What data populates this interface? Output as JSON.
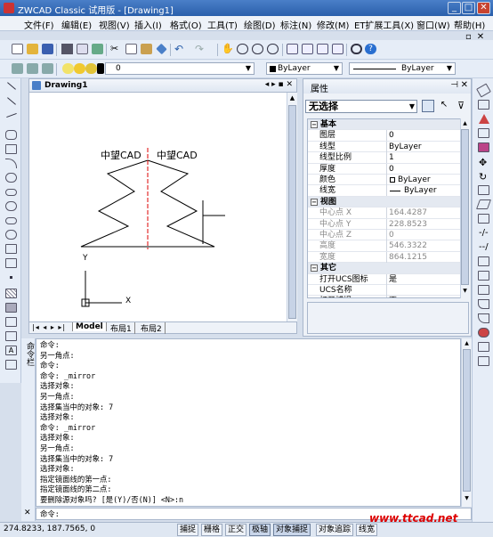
{
  "window": {
    "title": "ZWCAD Classic 试用版 - [Drawing1]",
    "controls": [
      "_",
      "□",
      "✕"
    ],
    "mdi_controls": [
      "_",
      "▫",
      "✕"
    ]
  },
  "menu": [
    "文件(F)",
    "编辑(E)",
    "视图(V)",
    "插入(I)",
    "格式(O)",
    "工具(T)",
    "绘图(D)",
    "标注(N)",
    "修改(M)",
    "ET扩展工具(X)",
    "窗口(W)",
    "帮助(H)"
  ],
  "layer_combo": "0",
  "color_combo": "ByLayer",
  "linetype_combo": "ByLayer",
  "drawing": {
    "tab_title": "Drawing1",
    "text_left": "中望CAD",
    "text_right": "中望CAD",
    "ucs_y": "Y",
    "ucs_x": "X",
    "layout_tabs": [
      "Model",
      "布局1",
      "布局2"
    ]
  },
  "properties": {
    "header": "属性",
    "selection": "无选择",
    "rows": [
      {
        "cat": true,
        "key": "基本"
      },
      {
        "key": "图层",
        "value": "0"
      },
      {
        "key": "线型",
        "value": "ByLayer"
      },
      {
        "key": "线型比例",
        "value": "1"
      },
      {
        "key": "厚度",
        "value": "0"
      },
      {
        "key": "颜色",
        "value": "ByLayer"
      },
      {
        "key": "线宽",
        "value": "ByLayer"
      },
      {
        "cat": true,
        "key": "视图"
      },
      {
        "key": "中心点 X",
        "value": "164.4287",
        "gray": true
      },
      {
        "key": "中心点 Y",
        "value": "228.8523",
        "gray": true
      },
      {
        "key": "中心点 Z",
        "value": "0",
        "gray": true
      },
      {
        "key": "高度",
        "value": "546.3322",
        "gray": true
      },
      {
        "key": "宽度",
        "value": "864.1215",
        "gray": true
      },
      {
        "cat": true,
        "key": "其它"
      },
      {
        "key": "打开UCS图标",
        "value": "是"
      },
      {
        "key": "UCS名称",
        "value": ""
      },
      {
        "key": "打开捕捉",
        "value": "否"
      }
    ]
  },
  "command": {
    "side_label": "命令栏",
    "lines": [
      "命令:",
      "另一角点:",
      "命令:",
      "命令: _mirror",
      "选择对象:",
      "另一角点:",
      "选择集当中的对象: 7",
      "选择对象:",
      "命令: _mirror",
      "选择对象:",
      "另一角点:",
      "选择集当中的对象: 7",
      "选择对象:",
      "指定镜面线的第一点:",
      "指定镜面线的第二点:",
      "要删除源对象吗? [是(Y)/否(N)] <N>:n"
    ],
    "prompt": "命令:"
  },
  "status": {
    "coords": "274.8233, 187.7565, 0",
    "buttons": [
      {
        "label": "捕捉",
        "on": false
      },
      {
        "label": "栅格",
        "on": false
      },
      {
        "label": "正交",
        "on": false
      },
      {
        "label": "极轴",
        "on": true
      },
      {
        "label": "对象捕捉",
        "on": true
      },
      {
        "label": "对象追踪",
        "on": false
      },
      {
        "label": "线宽",
        "on": false
      }
    ]
  },
  "watermark": "www.ttcad.net"
}
